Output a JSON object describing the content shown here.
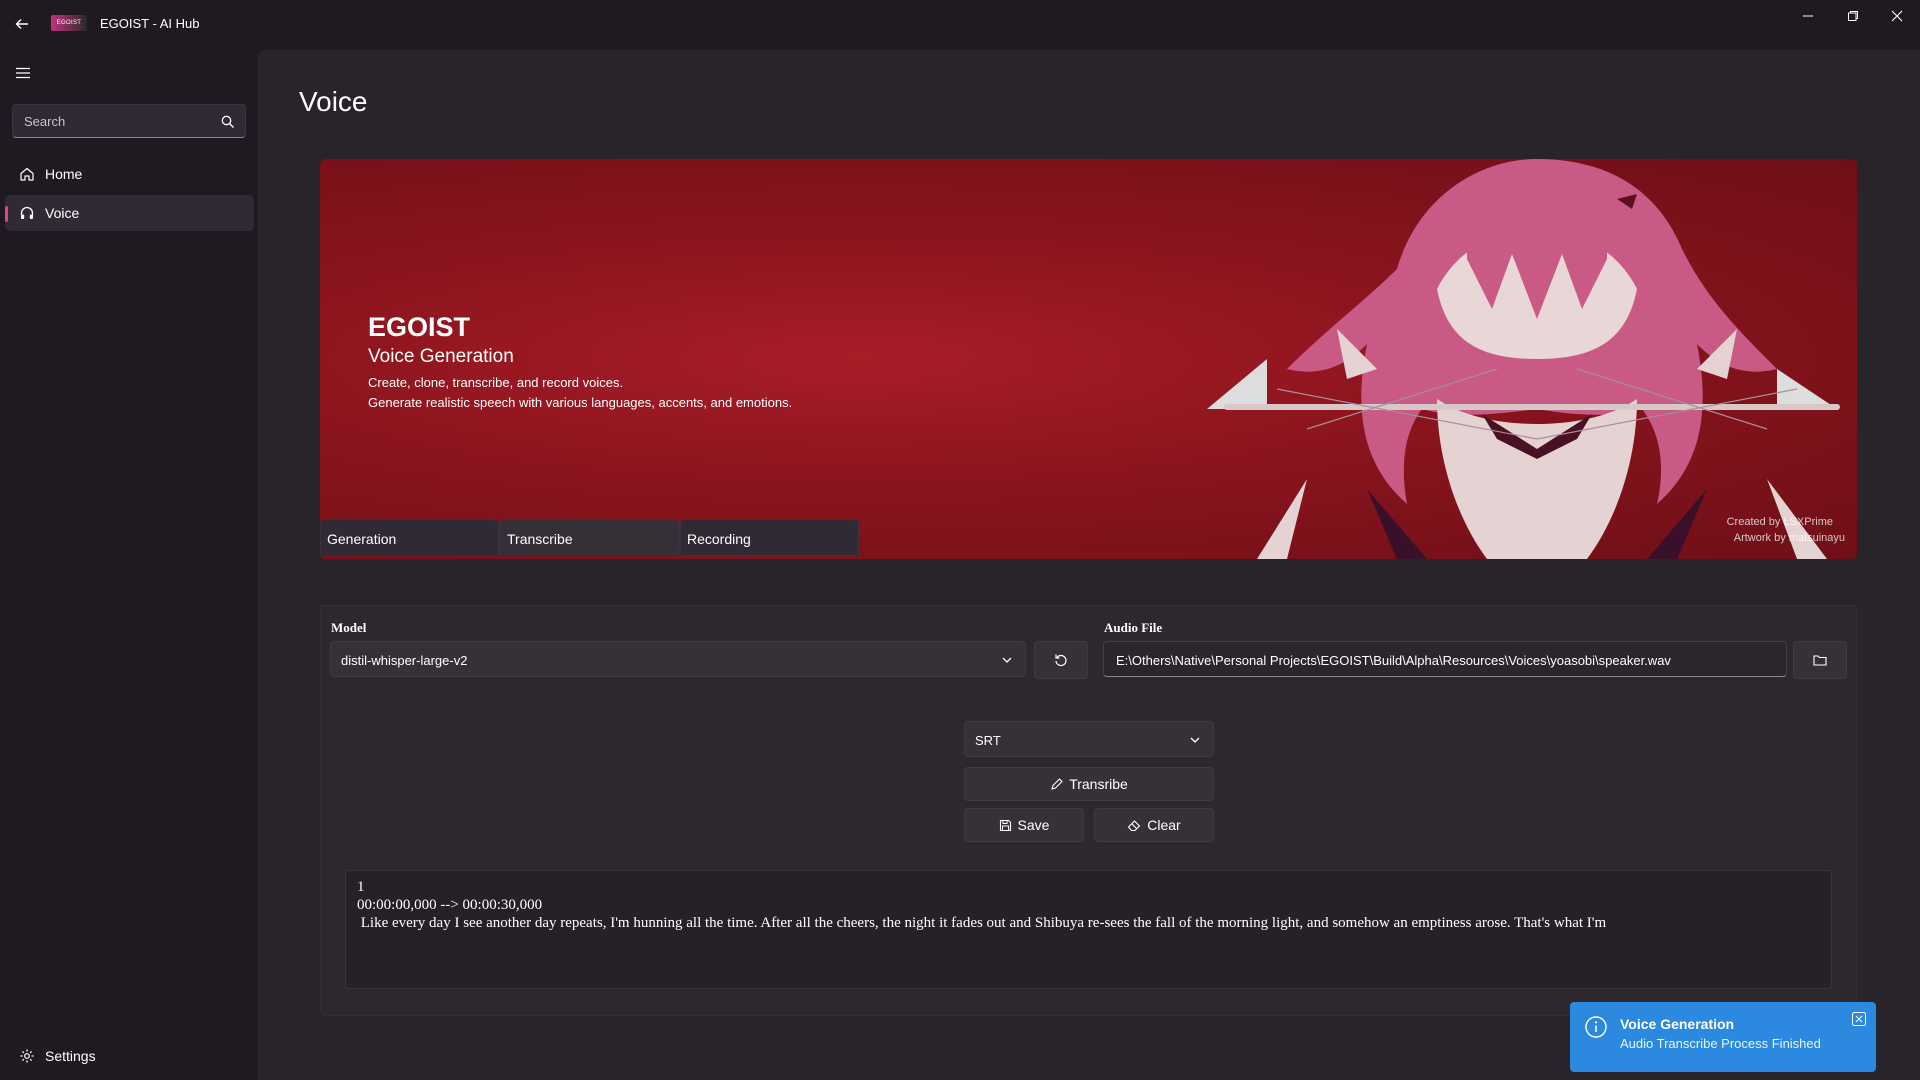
{
  "titlebar": {
    "title": "EGOIST - AI Hub",
    "logo_text": "EGOIST"
  },
  "sidebar": {
    "search_placeholder": "Search",
    "items": [
      {
        "label": "Home",
        "icon": "home-icon"
      },
      {
        "label": "Voice",
        "icon": "headphones-icon",
        "active": true
      }
    ],
    "settings_label": "Settings"
  },
  "main": {
    "page_title": "Voice",
    "hero": {
      "title": "EGOIST",
      "subtitle": "Voice Generation",
      "desc1": "Create, clone, transcribe, and record voices.",
      "desc2": "Generate realistic speech with various languages, accents, and emotions.",
      "credit1": "Created by LSXPrime",
      "credit2": "Artwork by matsuinayu"
    },
    "tabs": [
      {
        "label": "Generation"
      },
      {
        "label": "Transcribe",
        "active": true
      },
      {
        "label": "Recording"
      }
    ],
    "model": {
      "label": "Model",
      "value": "distil-whisper-large-v2"
    },
    "audio_file": {
      "label": "Audio File",
      "value": "E:\\Others\\Native\\Personal Projects\\EGOIST\\Build\\Alpha\\Resources\\Voices\\yoasobi\\speaker.wav"
    },
    "format": {
      "value": "SRT"
    },
    "transcribe_label": "Transribe",
    "save_label": "Save",
    "clear_label": "Clear",
    "output_text": "1\n00:00:00,000 --> 00:00:30,000\n Like every day I see another day repeats, I'm hunning all the time. After all the cheers, the night it fades out and Shibuya re-sees the fall of the morning light, and somehow an emptiness arose. That's what I'm"
  },
  "toast": {
    "title": "Voice Generation",
    "message": "Audio Transcribe Process Finished"
  },
  "colors": {
    "accent": "#e0457b",
    "hero_red": "#8a141d",
    "toast_blue": "#2b8ae0"
  }
}
